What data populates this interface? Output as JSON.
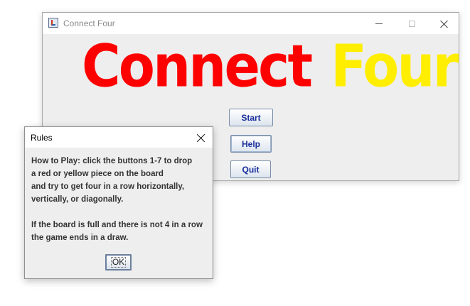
{
  "main_window": {
    "title": "Connect Four",
    "logo": {
      "word_1": "Connect",
      "word_2": "Four",
      "word_1_color": "#ff0000",
      "word_2_color": "#ffee00"
    },
    "buttons": {
      "start": "Start",
      "help": "Help",
      "quit": "Quit"
    },
    "window_controls": [
      "minimize-icon",
      "maximize-icon",
      "close-icon"
    ]
  },
  "rules_dialog": {
    "title": "Rules",
    "message_lines": [
      "How to Play: click the buttons 1-7 to drop",
      "a red or yellow piece on the board",
      "and try to get four in a row horizontally,",
      "vertically, or diagonally.",
      "",
      "If the board is full and there is not 4 in a row",
      "the game ends in a draw."
    ],
    "ok_label": "OK"
  },
  "colors": {
    "button_text": "#1a2f9c",
    "window_bg": "#eeeeee"
  }
}
